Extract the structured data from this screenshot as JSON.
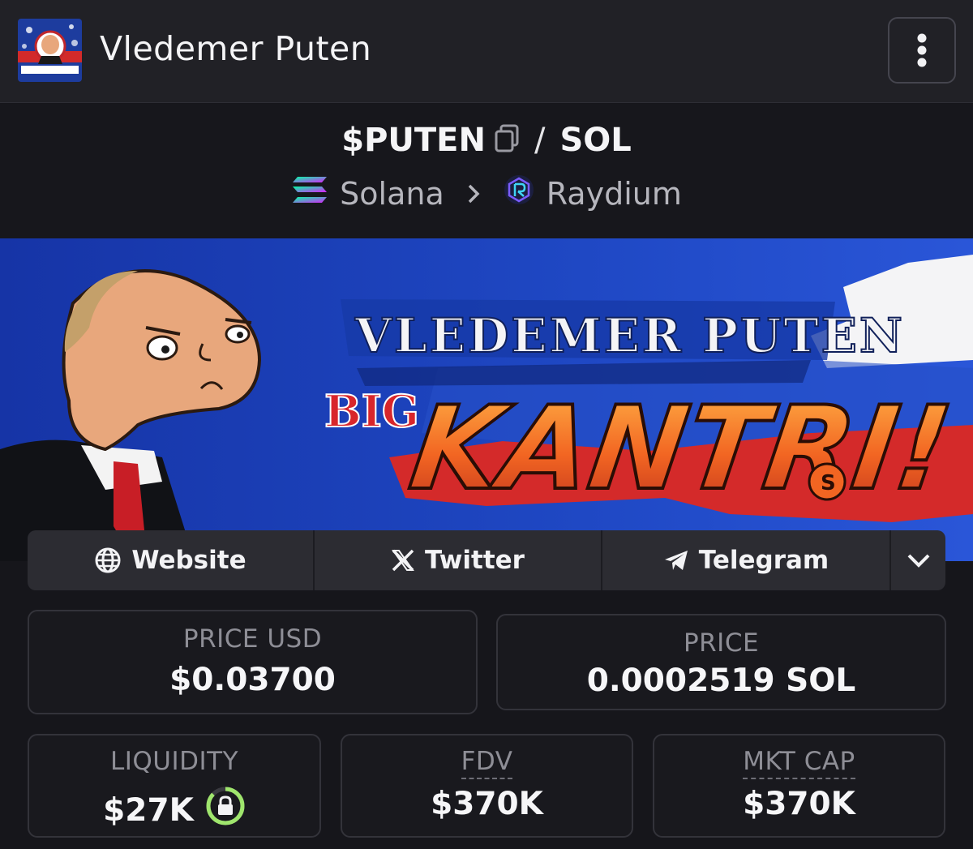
{
  "header": {
    "app_title": "Vledemer Puten",
    "logo_text": "VLEDEMER PUTEN",
    "menu_icon": "kebab-vertical-icon"
  },
  "pair": {
    "base": "$PUTEN",
    "separator": "/",
    "quote": "SOL",
    "chain": "Solana",
    "dex": "Raydium"
  },
  "banner": {
    "line1": "VLEDEMER PUTEN",
    "big": "BIG",
    "kantri": "KANTRI!"
  },
  "links": {
    "website": "Website",
    "twitter": "Twitter",
    "telegram": "Telegram"
  },
  "stats": {
    "price_usd_label": "PRICE USD",
    "price_usd_value": "$0.03700",
    "price_label": "PRICE",
    "price_value": "0.0002519 SOL",
    "liquidity_label": "LIQUIDITY",
    "liquidity_value": "$27K",
    "fdv_label": "FDV",
    "fdv_value": "$370K",
    "mktcap_label": "MKT CAP",
    "mktcap_value": "$370K"
  },
  "colors": {
    "background": "#16161b",
    "topbar": "#212126",
    "locked_green": "#9fe56d",
    "banner_blue": "#1e3fae",
    "banner_orange": "#f0612a"
  }
}
